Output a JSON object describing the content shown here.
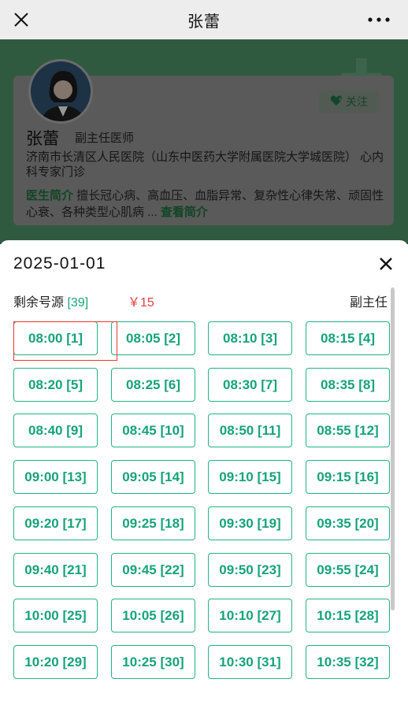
{
  "nav": {
    "title": "张蕾",
    "close_icon": "close-icon",
    "more_icon": "more-dots-icon"
  },
  "doctor": {
    "name": "张蕾",
    "title": "副主任医师",
    "hospital": "济南市长清区人民医院（山东中医药大学附属医院大学城医院） 心内科专家门诊",
    "follow_label": "关注",
    "intro_label": "医生简介",
    "intro_text": " 擅长冠心病、高血压、血脂异常、复杂性心律失常、顽固性心衰、各种类型心肌病 ... ",
    "intro_more": "查看简介"
  },
  "sheet": {
    "date": "2025-01-01",
    "remaining_label": "剩余号源",
    "remaining_count": "[39]",
    "price": "￥15",
    "level": "副主任",
    "accent_color": "#22b383",
    "price_color": "#e04040"
  },
  "slots": [
    "08:00 [1]",
    "08:05 [2]",
    "08:10 [3]",
    "08:15 [4]",
    "08:20 [5]",
    "08:25 [6]",
    "08:30 [7]",
    "08:35 [8]",
    "08:40 [9]",
    "08:45 [10]",
    "08:50 [11]",
    "08:55 [12]",
    "09:00 [13]",
    "09:05 [14]",
    "09:10 [15]",
    "09:15 [16]",
    "09:20 [17]",
    "09:25 [18]",
    "09:30 [19]",
    "09:35 [20]",
    "09:40 [21]",
    "09:45 [22]",
    "09:50 [23]",
    "09:55 [24]",
    "10:00 [25]",
    "10:05 [26]",
    "10:10 [27]",
    "10:15 [28]",
    "10:20 [29]",
    "10:25 [30]",
    "10:30 [31]",
    "10:35 [32]"
  ]
}
